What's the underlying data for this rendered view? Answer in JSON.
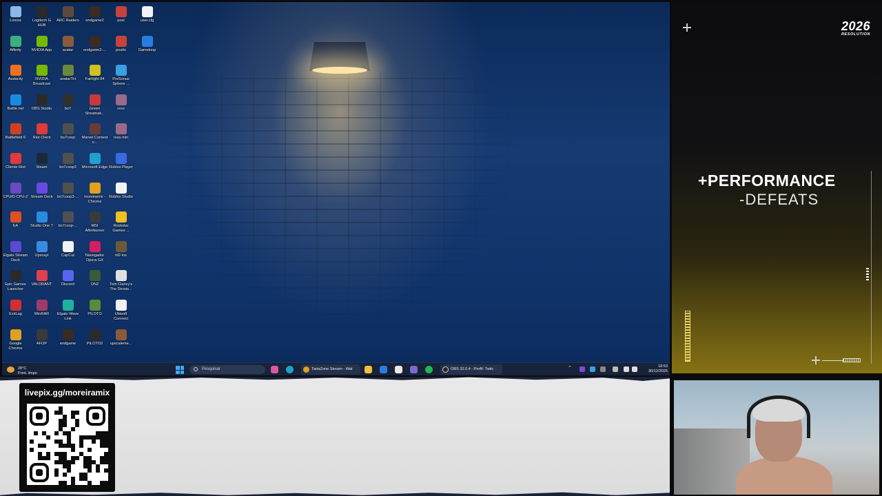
{
  "desktop": {
    "icons": [
      {
        "label": "Lixeira",
        "color": "#8fb6e8"
      },
      {
        "label": "Logitech G HUB",
        "color": "#2a2a2a"
      },
      {
        "label": "ARC Raiders",
        "color": "#5b4a3b"
      },
      {
        "label": "endgame2",
        "color": "#3b2a22"
      },
      {
        "label": "post",
        "color": "#c8423a"
      },
      {
        "label": "user.cfg",
        "color": "#f2f2f2"
      },
      {
        "label": "Affinity",
        "color": "#3ab07a"
      },
      {
        "label": "NVIDIA App",
        "color": "#76b900"
      },
      {
        "label": "avatar",
        "color": "#8a5a3a"
      },
      {
        "label": "endgame2-...",
        "color": "#3b2a22"
      },
      {
        "label": "posttx",
        "color": "#c8423a"
      },
      {
        "label": "Gameloop",
        "color": "#2a7de0"
      },
      {
        "label": "Audacity",
        "color": "#f07020"
      },
      {
        "label": "NVIDIA Broadcast",
        "color": "#76b900"
      },
      {
        "label": "avatarTH",
        "color": "#6a8a3a"
      },
      {
        "label": "Fairlight 84",
        "color": "#d0c020"
      },
      {
        "label": "PreSonus Sphere ...",
        "color": "#3aa0e0"
      },
      {
        "label": "Battle.net",
        "color": "#1a8ae0"
      },
      {
        "label": "OBS Studio",
        "color": "#2a2a2a"
      },
      {
        "label": "bo7",
        "color": "#303030"
      },
      {
        "label": "Green Streamak...",
        "color": "#c83a3a"
      },
      {
        "label": "ress",
        "color": "#9a6a8a"
      },
      {
        "label": "Battlefield 6",
        "color": "#d04020"
      },
      {
        "label": "Riot Client",
        "color": "#e03a3a"
      },
      {
        "label": "bo7coop",
        "color": "#505050"
      },
      {
        "label": "Marvel Contest o...",
        "color": "#6a3a3a"
      },
      {
        "label": "ress-min",
        "color": "#9a6a8a"
      },
      {
        "label": "Cliente Riot",
        "color": "#e03a3a"
      },
      {
        "label": "Steam",
        "color": "#1b2838"
      },
      {
        "label": "bo7coop3",
        "color": "#505050"
      },
      {
        "label": "Microsoft Edge",
        "color": "#1fa0d0"
      },
      {
        "label": "Roblox Player",
        "color": "#3a6ae0"
      },
      {
        "label": "CPUID CPU-Z",
        "color": "#6a4ac0"
      },
      {
        "label": "Stream Deck",
        "color": "#6a4ae0"
      },
      {
        "label": "bo7coop3-...",
        "color": "#505050"
      },
      {
        "label": "moreiramix - Chrome",
        "color": "#e0a020"
      },
      {
        "label": "Roblox Studio",
        "color": "#f2f2f2"
      },
      {
        "label": "EA",
        "color": "#e05020"
      },
      {
        "label": "Studio One 7",
        "color": "#2a8ae0"
      },
      {
        "label": "bo7coop-...",
        "color": "#505050"
      },
      {
        "label": "MSI Afterburner",
        "color": "#3a3a3a"
      },
      {
        "label": "Rockstar Games ...",
        "color": "#f0c020"
      },
      {
        "label": "Elgato Stream Deck",
        "color": "#5a4ad0"
      },
      {
        "label": "Upscayl",
        "color": "#3a8ae0"
      },
      {
        "label": "CapCut",
        "color": "#f2f2f2"
      },
      {
        "label": "Navegador Opera GX",
        "color": "#d02060"
      },
      {
        "label": "td2-ins",
        "color": "#6a5a3a"
      },
      {
        "label": "Epic Games Launcher",
        "color": "#2a2a2a"
      },
      {
        "label": "VALORANT",
        "color": "#e04050"
      },
      {
        "label": "Discord",
        "color": "#5865f2"
      },
      {
        "label": "ON2",
        "color": "#3a5a3a"
      },
      {
        "label": "Tom Clancy's The Divisio...",
        "color": "#e0e0e0"
      },
      {
        "label": "ExitLag",
        "color": "#d03030"
      },
      {
        "label": "WinRAR",
        "color": "#a03a6a"
      },
      {
        "label": "Elgato Wave Link",
        "color": "#20b0a0"
      },
      {
        "label": "PILOTO",
        "color": "#5a8a3a"
      },
      {
        "label": "Ubisoft Connect",
        "color": "#f2f2f2"
      },
      {
        "label": "Google Chrome",
        "color": "#e0a020"
      },
      {
        "label": "AFOP",
        "color": "#3a3a3a"
      },
      {
        "label": "endgame",
        "color": "#3b2a22"
      },
      {
        "label": "PILOTO2",
        "color": "#2a2a2a"
      },
      {
        "label": "upscaleme...",
        "color": "#8a5a3a"
      }
    ]
  },
  "taskbar": {
    "weather_temp": "28°C",
    "weather_desc": "Pred. limpo",
    "search_placeholder": "Pesquisar",
    "task_chrome": "TartaZone Stream - Wat",
    "task_obs": "OBS 32.0.4 - Perfil: Twitc",
    "clock_time": "18:53",
    "clock_date": "30/12/2025"
  },
  "side_panel": {
    "logo_year": "2026",
    "logo_sub": "RESOLUTION",
    "line1": "+PERFORMANCE",
    "line2": "-DEFEATS"
  },
  "banner": {
    "livepix_url": "livepix.gg/moreiramix"
  },
  "colors": {
    "accent_gold": "#e4d060",
    "taskbar_bg": "#17233a"
  }
}
